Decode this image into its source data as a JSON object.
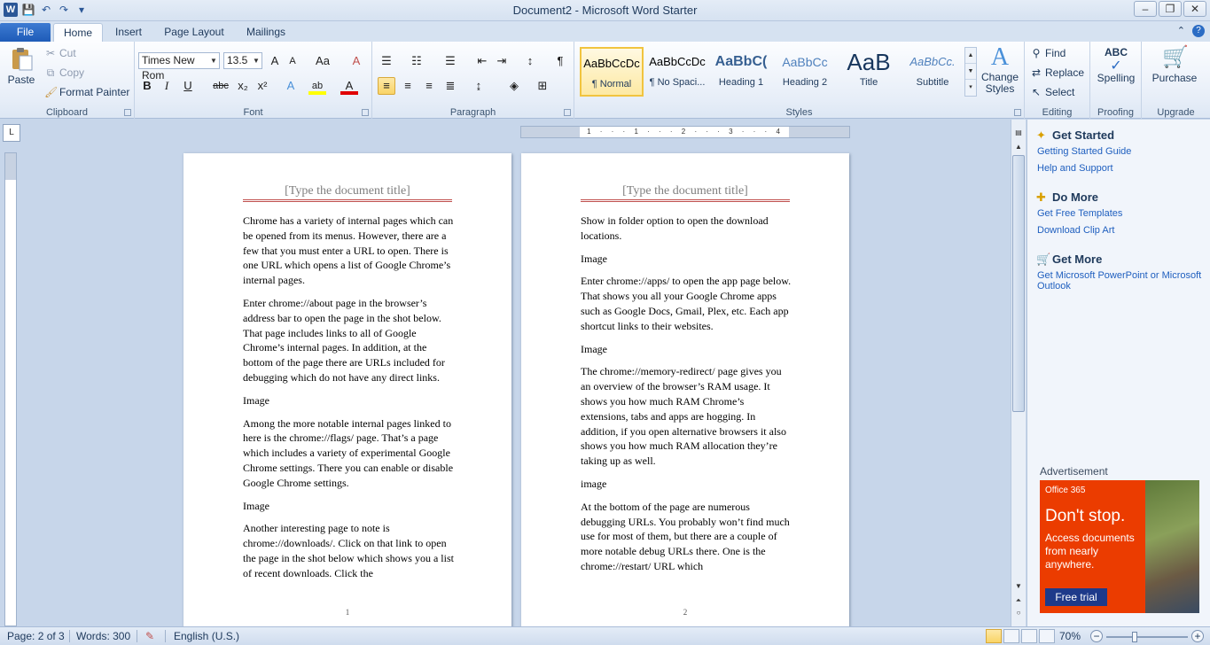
{
  "window": {
    "title": "Document2 - Microsoft Word Starter",
    "qat": [
      {
        "icon": "word-logo-icon",
        "glyph": "W"
      },
      {
        "icon": "save-icon",
        "glyph": "💾"
      },
      {
        "icon": "undo-icon",
        "glyph": "↶"
      },
      {
        "icon": "redo-icon",
        "glyph": "↷"
      },
      {
        "icon": "customize-qat-icon",
        "glyph": "▾"
      }
    ],
    "controls": {
      "minimize": "–",
      "restore": "❐",
      "close": "✕"
    }
  },
  "tabs": {
    "file": "File",
    "home": "Home",
    "insert": "Insert",
    "page_layout": "Page Layout",
    "mailings": "Mailings"
  },
  "ribbon": {
    "clipboard": {
      "label": "Clipboard",
      "paste": "Paste",
      "cut": "Cut",
      "copy": "Copy",
      "format_painter": "Format Painter"
    },
    "font": {
      "label": "Font",
      "font_name": "Times New Rom",
      "font_size": "13.5",
      "grow": "A",
      "shrink": "A",
      "change_case": "Aa",
      "clear_formatting": "A",
      "bold": "B",
      "italic": "I",
      "underline": "U",
      "strikethrough": "abc",
      "subscript": "x₂",
      "superscript": "x²",
      "text_effects": "A",
      "highlight": "ab",
      "font_color": "A"
    },
    "paragraph": {
      "label": "Paragraph"
    },
    "styles": {
      "label": "Styles",
      "items": [
        {
          "preview": "AaBbCcDc",
          "name": "¶ Normal"
        },
        {
          "preview": "AaBbCcDc",
          "name": "¶ No Spaci..."
        },
        {
          "preview": "AaBbC(",
          "name": "Heading 1"
        },
        {
          "preview": "AaBbCc",
          "name": "Heading 2"
        },
        {
          "preview": "AaB",
          "name": "Title"
        },
        {
          "preview": "AaBbCc.",
          "name": "Subtitle"
        }
      ],
      "change_styles": "Change Styles"
    },
    "editing": {
      "label": "Editing",
      "find": "Find",
      "replace": "Replace",
      "select": "Select"
    },
    "proofing": {
      "label": "Proofing",
      "spelling": "Spelling",
      "abc": "ABC"
    },
    "upgrade": {
      "label": "Upgrade",
      "purchase": "Purchase"
    }
  },
  "ruler": {
    "h_numbers": "1 · · · 1 · · · 2 · · · 3 · · · 4"
  },
  "pages": [
    {
      "title_placeholder": "[Type the document title]",
      "paragraphs": [
        "Chrome has a variety of internal pages which can be opened from its menus. However, there are a few that you must enter a URL to open. There is one URL which opens a list of Google Chrome’s internal pages.",
        "Enter chrome://about page in the browser’s address bar to open the page in the shot below. That page includes links to all of Google Chrome’s internal pages. In addition, at the bottom of the page there are URLs included for debugging which do not have any direct links.",
        "Image",
        "Among the more notable internal pages linked to here is the chrome://flags/ page. That’s a page which includes a variety of experimental Google Chrome settings. There you can enable or disable Google Chrome settings.",
        "Image",
        "Another interesting page to note is chrome://downloads/. Click on that link to open the page in the shot below which shows you a list of recent downloads. Click the"
      ],
      "page_number": "1"
    },
    {
      "title_placeholder": "[Type the document title]",
      "paragraphs": [
        "Show in folder option to open the download locations.",
        "Image",
        "Enter chrome://apps/ to open the app page below. That shows you all your Google Chrome apps such as Google Docs, Gmail, Plex, etc. Each app shortcut links to their websites.",
        "Image",
        "The chrome://memory-redirect/ page gives you an overview of the browser’s RAM usage. It shows you how much RAM Chrome’s extensions, tabs and apps are hogging. In addition, if you open alternative browsers it also shows you how much RAM allocation they’re taking up as well.",
        "image",
        "At the bottom of the page are numerous debugging URLs. You probably won’t find much use for most of them, but there are a couple of more notable debug URLs there. One is the chrome://restart/ URL which"
      ],
      "page_number": "2"
    }
  ],
  "side_panel": {
    "get_started": "Get Started",
    "getting_started_guide": "Getting Started Guide",
    "help_support": "Help and Support",
    "do_more": "Do More",
    "free_templates": "Get Free Templates",
    "clip_art": "Download Clip Art",
    "get_more": "Get More",
    "get_office": "Get Microsoft PowerPoint or Microsoft Outlook",
    "ad_label": "Advertisement",
    "ad_brand": "Office 365",
    "ad_headline": "Don't stop.",
    "ad_text": "Access documents from nearly anywhere.",
    "ad_cta": "Free trial"
  },
  "status": {
    "page": "Page: 2 of 3",
    "words": "Words: 300",
    "language": "English (U.S.)",
    "zoom": "70%",
    "zoom_level_percent": 70
  },
  "colors": {
    "accent": "#2b5797",
    "title_rule": "#c0504d",
    "ad_bg": "#eb3c00"
  }
}
